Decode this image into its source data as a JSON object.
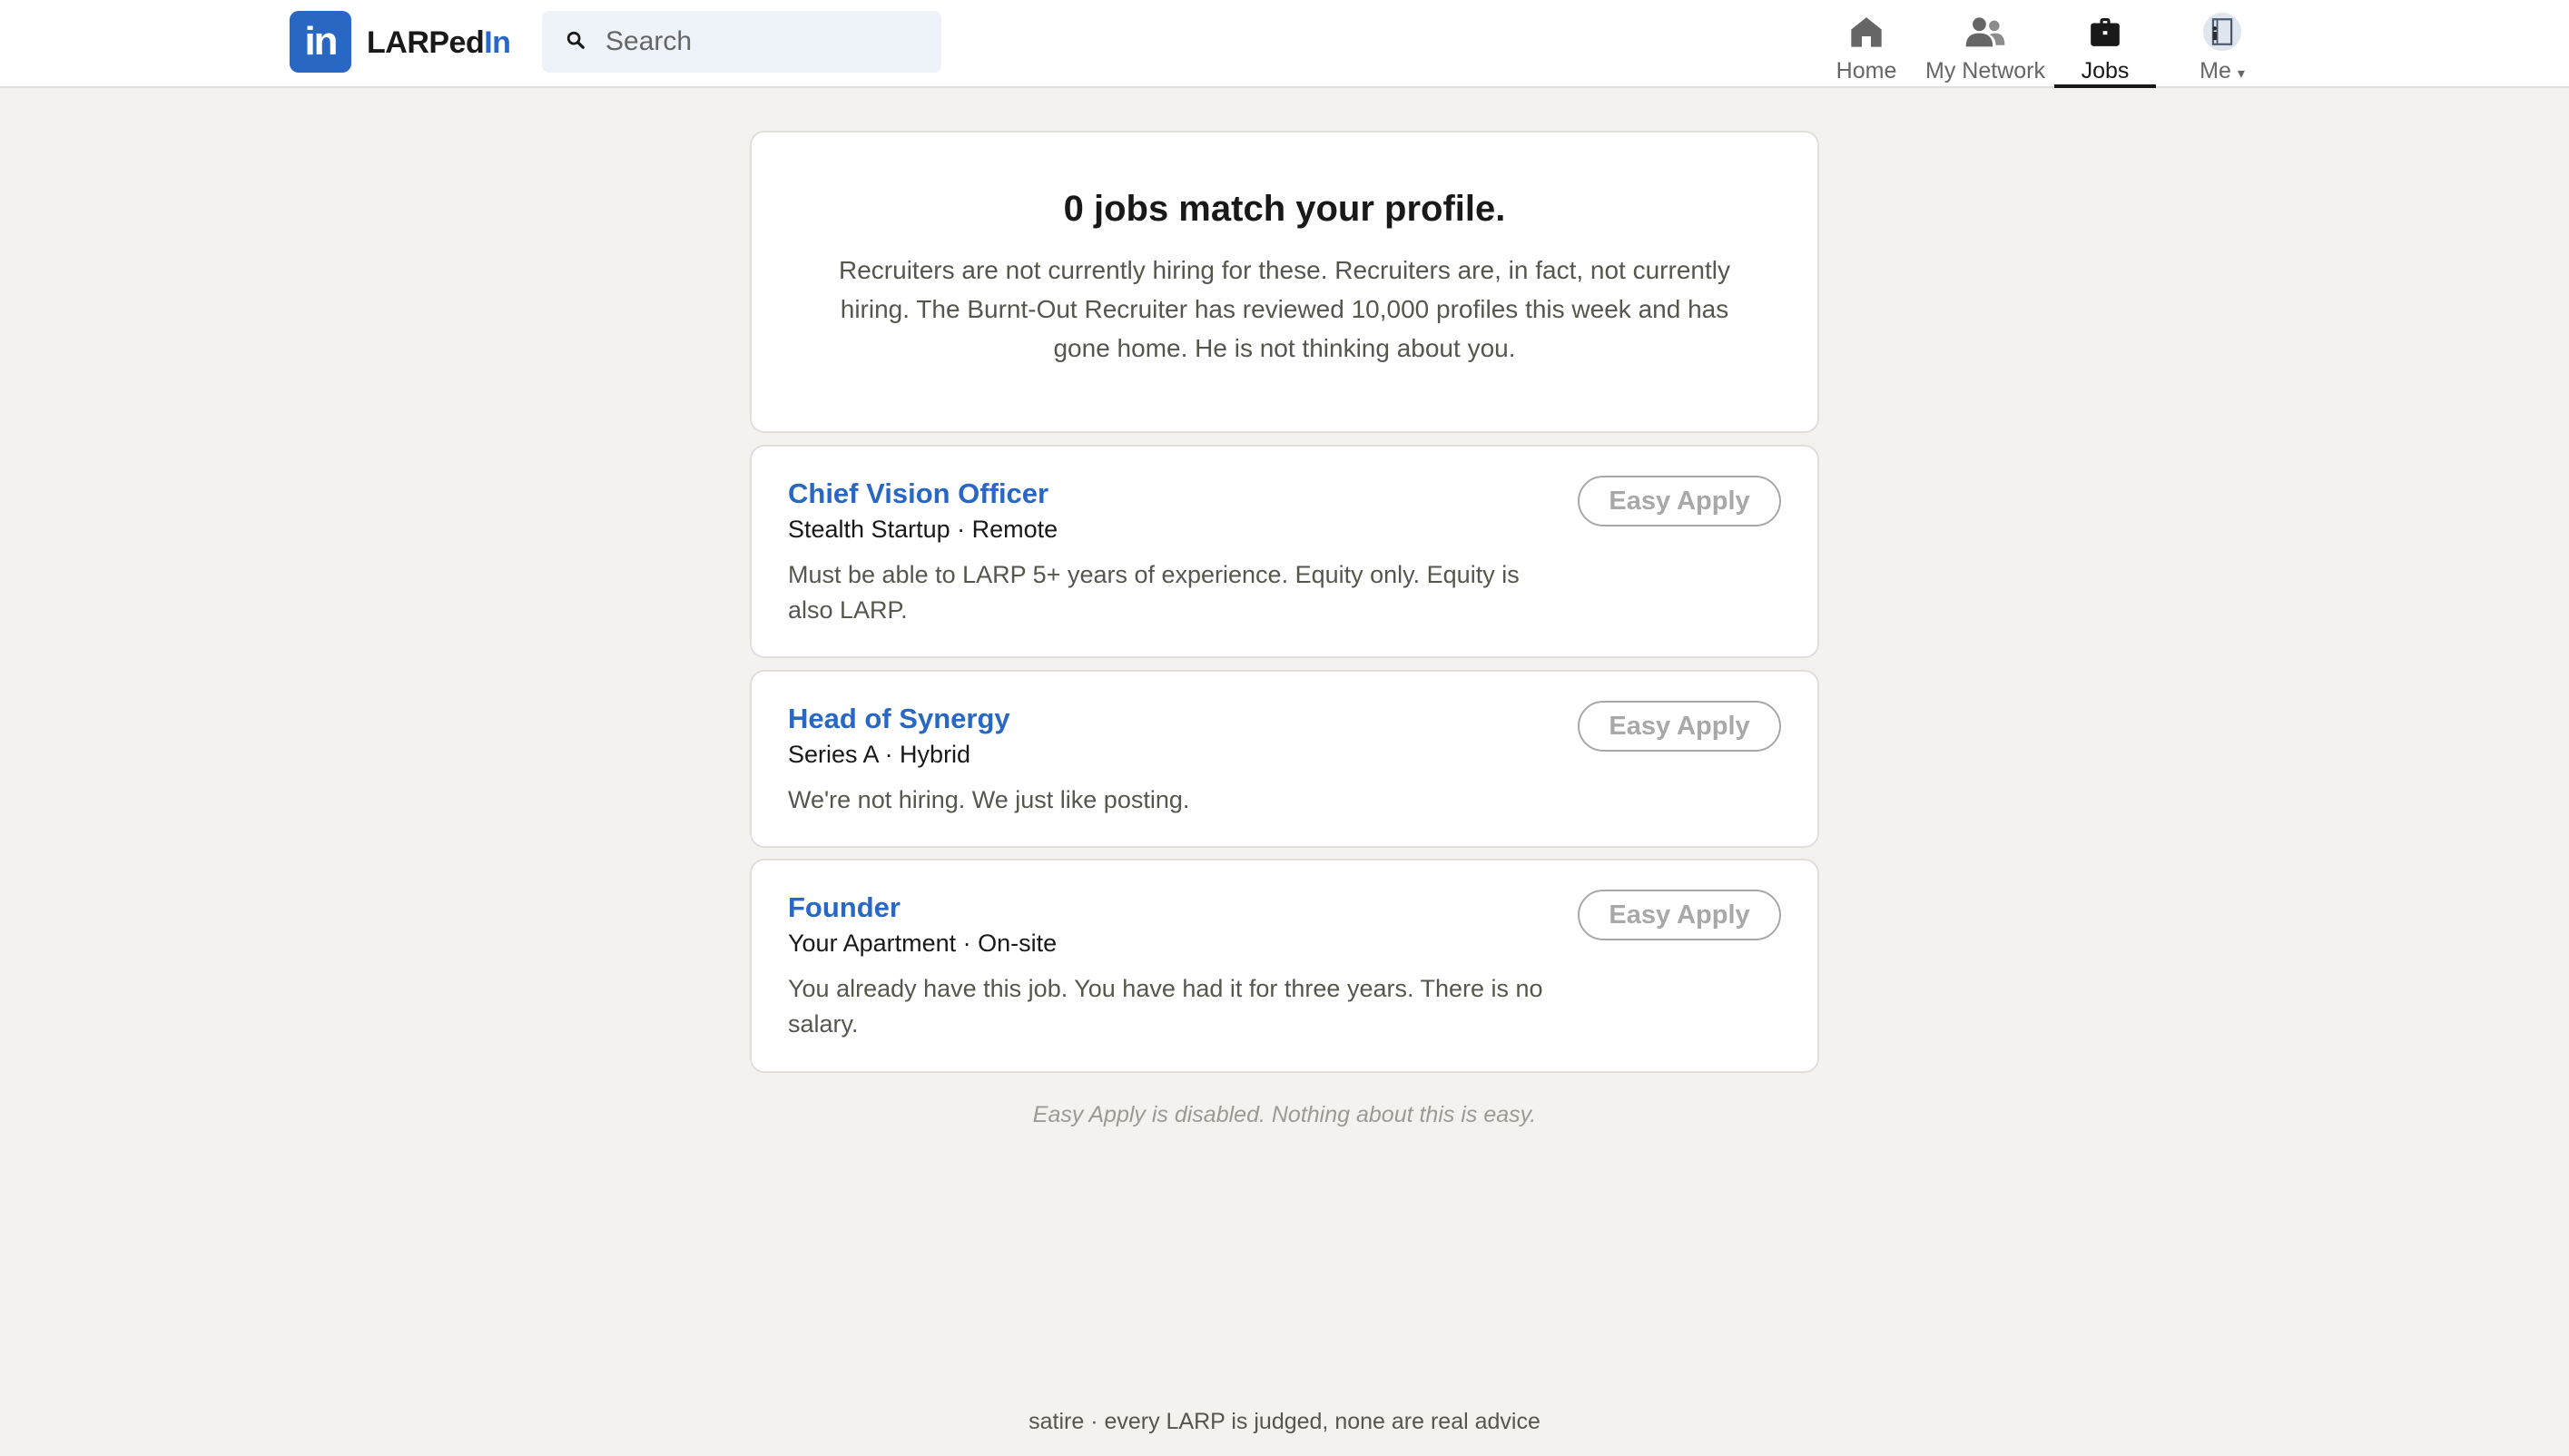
{
  "brand": {
    "logo_text": "in",
    "name_part1": "LARPed",
    "name_part2": "In",
    "accent": "#2867c4"
  },
  "search": {
    "placeholder": "Search",
    "value": ""
  },
  "nav": {
    "items": [
      {
        "label": "Home",
        "icon": "home-icon"
      },
      {
        "label": "My Network",
        "icon": "network-icon"
      },
      {
        "label": "Jobs",
        "icon": "briefcase-icon",
        "active": true
      },
      {
        "label": "Me",
        "icon": "avatar-icon",
        "caret": "▾"
      }
    ]
  },
  "hero": {
    "title": "0 jobs match your profile.",
    "body": "Recruiters are not currently hiring for these. Recruiters are, in fact, not currently hiring. The Burnt-Out Recruiter has reviewed 10,000 profiles this week and has gone home. He is not thinking about you."
  },
  "jobs": [
    {
      "title": "Chief Vision Officer",
      "meta": "Stealth Startup · Remote",
      "description": "Must be able to LARP 5+ years of experience. Equity only. Equity is also LARP.",
      "apply_label": "Easy Apply"
    },
    {
      "title": "Head of Synergy",
      "meta": "Series A · Hybrid",
      "description": "We're not hiring. We just like posting.",
      "apply_label": "Easy Apply"
    },
    {
      "title": "Founder",
      "meta": "Your Apartment · On-site",
      "description": "You already have this job. You have had it for three years. There is no salary.",
      "apply_label": "Easy Apply"
    }
  ],
  "note": "Easy Apply is disabled. Nothing about this is easy.",
  "footer": "satire · every LARP is judged, none are real advice"
}
